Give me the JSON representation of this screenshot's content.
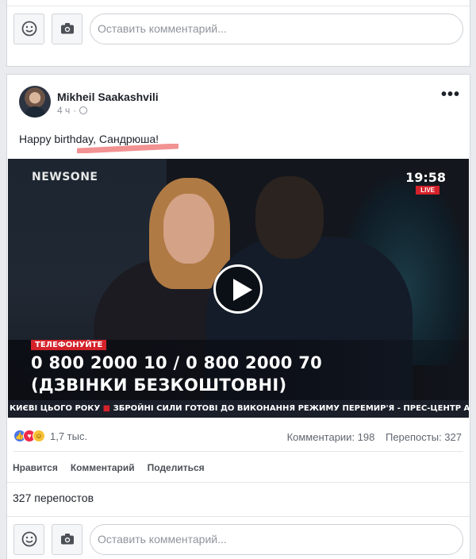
{
  "top_composer": {
    "placeholder": "Оставить комментарий..."
  },
  "post": {
    "author": "Mikheil Saakashvili",
    "time": "4 ч",
    "text": "Happy birthday, Сандрюша!",
    "video": {
      "channel_logo": "NEWSONE",
      "clock": "19:58",
      "live_badge": "LIVE",
      "call_tag": "ТЕЛЕФОНУЙТЕ",
      "phone_line": "0 800 2000 10 / 0 800 2000 70",
      "free_line": "(ДЗВІНКИ БЕЗКОШТОВНІ)",
      "ticker_left": "КИЄВІ ЦЬОГО РОКУ",
      "ticker_right": "ЗБРОЙНІ СИЛИ ГОТОВІ ДО ВИКОНАННЯ РЕЖИМУ ПЕРЕМИР'Я - ПРЕС-ЦЕНТР А"
    },
    "reactions_count": "1,7 тыс.",
    "comments_count": "Комментарии: 198",
    "shares_count": "Перепосты: 327",
    "actions": {
      "like": "Нравится",
      "comment": "Комментарий",
      "share": "Поделиться"
    },
    "shares_text": "327 перепостов"
  },
  "bottom_composer": {
    "placeholder": "Оставить комментарий..."
  },
  "colors": {
    "accent_red": "#d4222b",
    "annotation_pink": "#f08080",
    "link_blue": "#4a76e8"
  }
}
